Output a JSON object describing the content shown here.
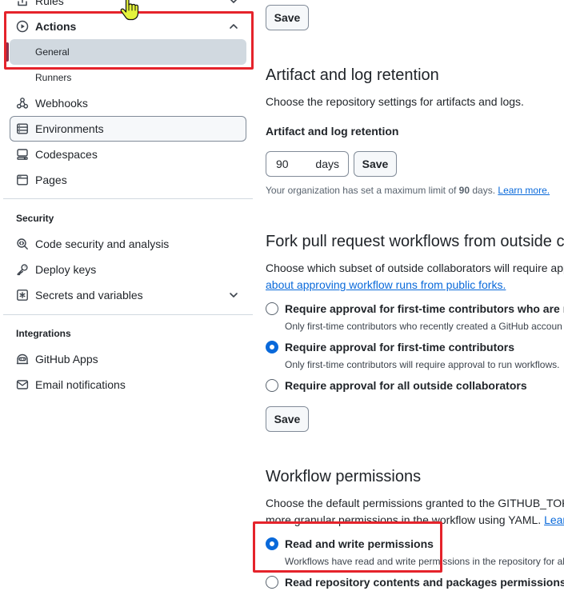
{
  "sidebar": {
    "rules": {
      "label": "Rules",
      "icon": "rules-icon",
      "chevron": "chevron-down-icon"
    },
    "actions": {
      "label": "Actions",
      "icon": "play-icon",
      "chevron": "chevron-up-icon",
      "expanded": true
    },
    "actions_subitems": [
      {
        "label": "General",
        "selected": true
      },
      {
        "label": "Runners",
        "selected": false
      }
    ],
    "nav_items": [
      {
        "label": "Webhooks",
        "icon": "webhook-icon"
      },
      {
        "label": "Environments",
        "icon": "server-icon",
        "focused": true
      },
      {
        "label": "Codespaces",
        "icon": "codespaces-icon"
      },
      {
        "label": "Pages",
        "icon": "browser-icon"
      }
    ],
    "security": {
      "heading": "Security",
      "items": [
        {
          "label": "Code security and analysis",
          "icon": "codescan-icon"
        },
        {
          "label": "Deploy keys",
          "icon": "key-icon"
        },
        {
          "label": "Secrets and variables",
          "icon": "asterisk-box-icon",
          "chevron": "chevron-down-icon"
        }
      ]
    },
    "integrations": {
      "heading": "Integrations",
      "items": [
        {
          "label": "GitHub Apps",
          "icon": "hubot-icon"
        },
        {
          "label": "Email notifications",
          "icon": "mail-icon"
        }
      ]
    }
  },
  "main": {
    "top_save_label": "Save",
    "artifact_retention": {
      "heading": "Artifact and log retention",
      "description": "Choose the repository settings for artifacts and logs.",
      "field_label": "Artifact and log retention",
      "field_value": "90",
      "field_unit": "days",
      "save_label": "Save",
      "note_prefix": "Your organization has set a maximum limit of ",
      "note_limit": "90",
      "note_suffix": " days. ",
      "note_link": "Learn more."
    },
    "fork_workflows": {
      "heading": "Fork pull request workflows from outside c",
      "description": "Choose which subset of outside collaborators will require app",
      "description_link": "about approving workflow runs from public forks.",
      "options": [
        {
          "label": "Require approval for first-time contributors who are ne",
          "caption": "Only first-time contributors who recently created a GitHub accoun",
          "checked": false
        },
        {
          "label": "Require approval for first-time contributors",
          "caption": "Only first-time contributors will require approval to run workflows.",
          "checked": true
        },
        {
          "label": "Require approval for all outside collaborators",
          "checked": false
        }
      ],
      "save_label": "Save"
    },
    "workflow_permissions": {
      "heading": "Workflow permissions",
      "description_line1": "Choose the default permissions granted to the GITHUB_TOKE",
      "description_line2": "more granular permissions in the workflow using YAML. ",
      "description_link": "Lear",
      "options": [
        {
          "label": "Read and write permissions",
          "caption": "Workflows have read and write permissions in the repository for al",
          "checked": true
        },
        {
          "label": "Read repository contents and packages permissions",
          "checked": false
        }
      ]
    }
  },
  "colors": {
    "text": "#1f2328",
    "muted": "#59636e",
    "icon": "#3d444d",
    "link": "#0969da",
    "accent": "#0969da",
    "selected_bg": "#d1d9e0",
    "selected_marker": "#8c2f4b",
    "border": "#d1d9e0",
    "border_strong": "#818b98",
    "annotation": "#e5232b",
    "cursor_fill": "#e4f23c"
  }
}
